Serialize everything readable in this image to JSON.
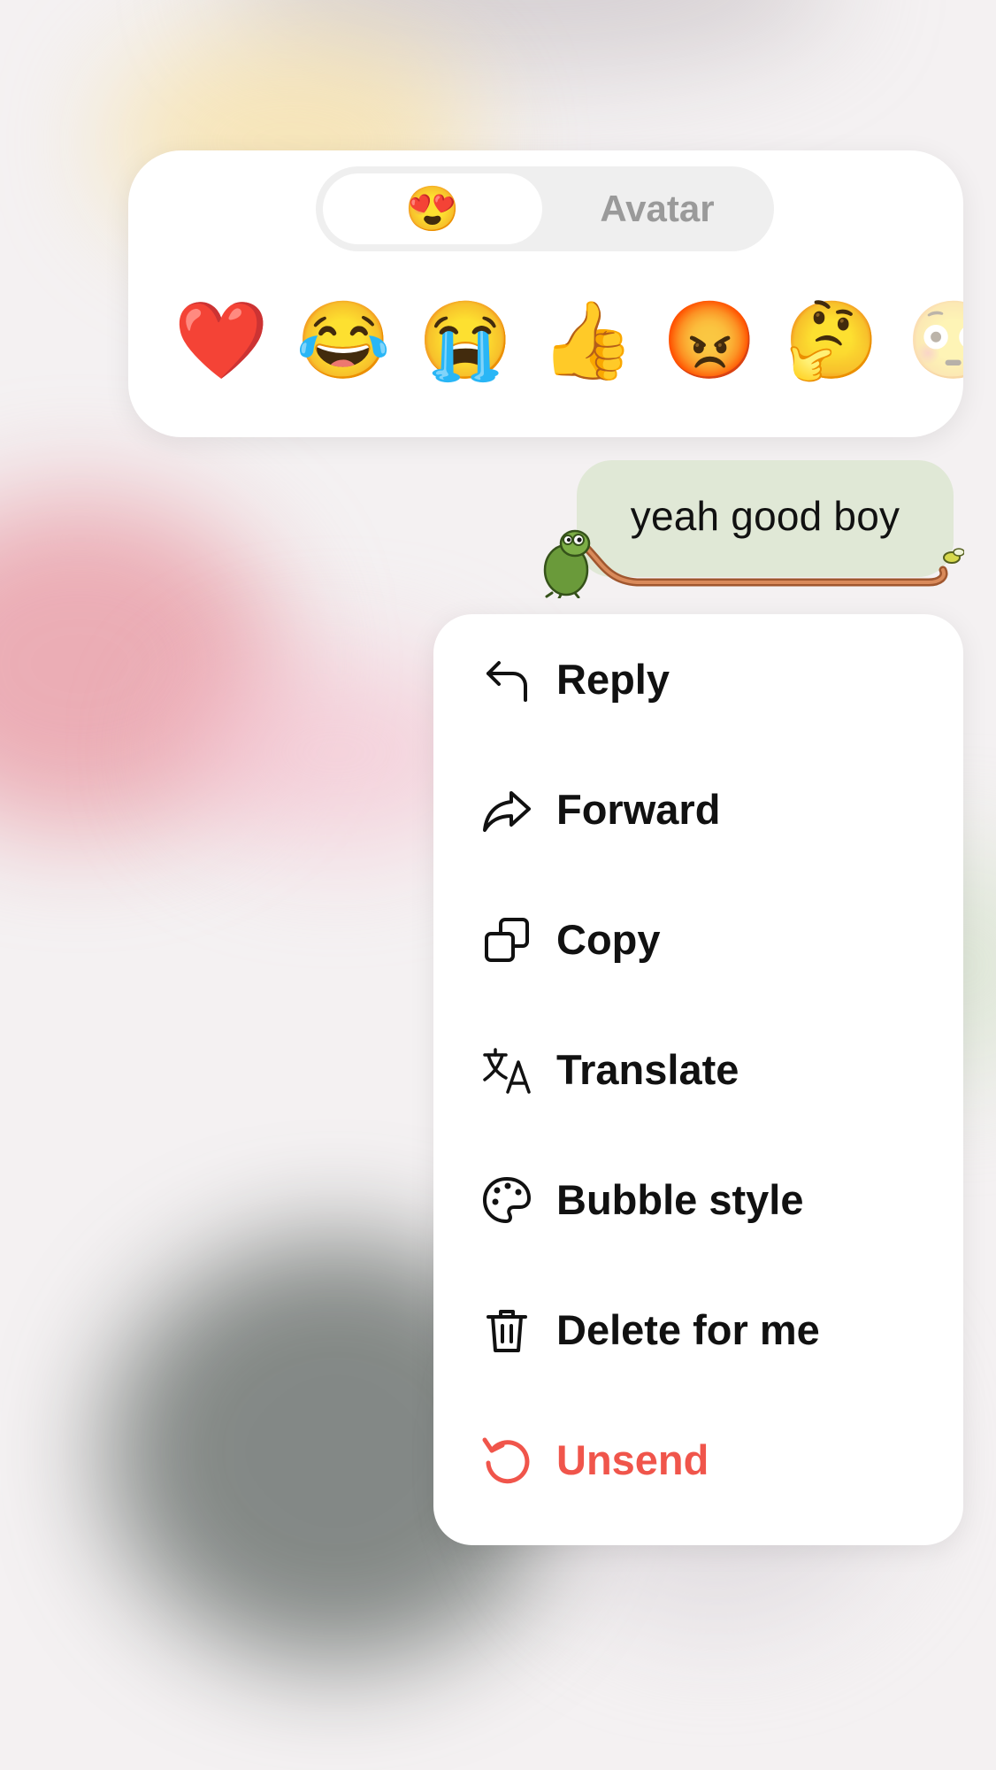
{
  "reaction_panel": {
    "tabs": [
      {
        "label": "😍",
        "selected": true
      },
      {
        "label": "Avatar",
        "selected": false
      }
    ],
    "emojis": [
      {
        "char": "❤️",
        "icon": "red-heart"
      },
      {
        "char": "😂",
        "icon": "tears-of-joy"
      },
      {
        "char": "😭",
        "icon": "loudly-crying"
      },
      {
        "char": "👍",
        "icon": "thumbs-up"
      },
      {
        "char": "😡",
        "icon": "angry-face"
      },
      {
        "char": "🤔",
        "icon": "thinking-face"
      },
      {
        "char": "😳",
        "icon": "flushed-face"
      }
    ]
  },
  "message": {
    "text": "yeah good boy",
    "bubble_color": "#e0e8d6"
  },
  "menu": {
    "items": [
      {
        "label": "Reply",
        "icon": "reply-icon"
      },
      {
        "label": "Forward",
        "icon": "forward-icon"
      },
      {
        "label": "Copy",
        "icon": "copy-icon"
      },
      {
        "label": "Translate",
        "icon": "translate-icon"
      },
      {
        "label": "Bubble style",
        "icon": "palette-icon"
      },
      {
        "label": "Delete for me",
        "icon": "trash-icon"
      },
      {
        "label": "Unsend",
        "icon": "undo-icon",
        "color": "#f0554b"
      }
    ]
  }
}
